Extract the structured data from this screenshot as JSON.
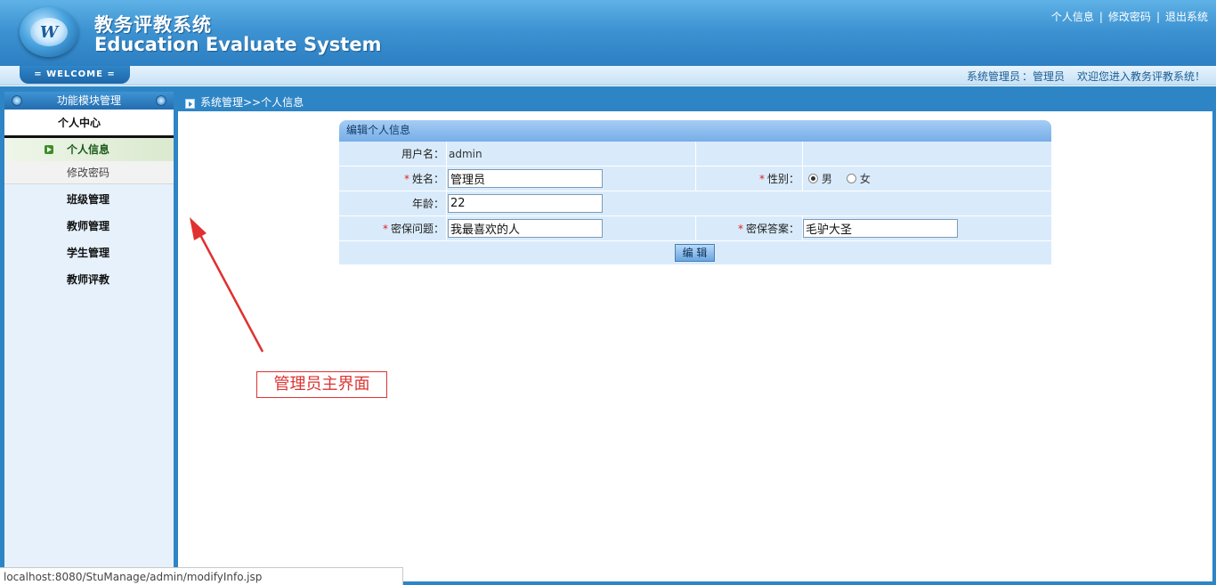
{
  "header": {
    "logo_letter": "W",
    "title_cn": "教务评教系统",
    "title_en": "Education Evaluate System",
    "links": {
      "personal_info": "个人信息",
      "change_password": "修改密码",
      "logout": "退出系统",
      "separator": "|"
    }
  },
  "welcome_bar": {
    "tab_label": "= WELCOME =",
    "role_label": "系统管理员",
    "role_sep": "：",
    "user_name": "管理员",
    "greeting": "欢迎您进入教务评教系统！"
  },
  "sidebar": {
    "title": "功能模块管理",
    "group_title": "个人中心",
    "active_item": "个人信息",
    "sub_item": "修改密码",
    "items": [
      "班级管理",
      "教师管理",
      "学生管理",
      "教师评教"
    ]
  },
  "breadcrumb": "系统管理>>个人信息",
  "form": {
    "title": "编辑个人信息",
    "username_label": "用户名：",
    "username_value": "admin",
    "name_label": "姓名：",
    "name_value": "管理员",
    "gender_label": "性别：",
    "gender_options": [
      "男",
      "女"
    ],
    "gender_selected": "男",
    "age_label": "年龄：",
    "age_value": "22",
    "question_label": "密保问题：",
    "question_value": "我最喜欢的人",
    "answer_label": "密保答案：",
    "answer_value": "毛驴大圣",
    "required_mark": "*",
    "submit_label": "编 辑"
  },
  "annotation": "管理员主界面",
  "status_url": "localhost:8080/StuManage/admin/modifyInfo.jsp",
  "colors": {
    "header_blue": "#3d93d2",
    "frame_blue": "#2e85c6",
    "form_row": "#d9ebfb",
    "annotation_red": "#dd3333"
  }
}
